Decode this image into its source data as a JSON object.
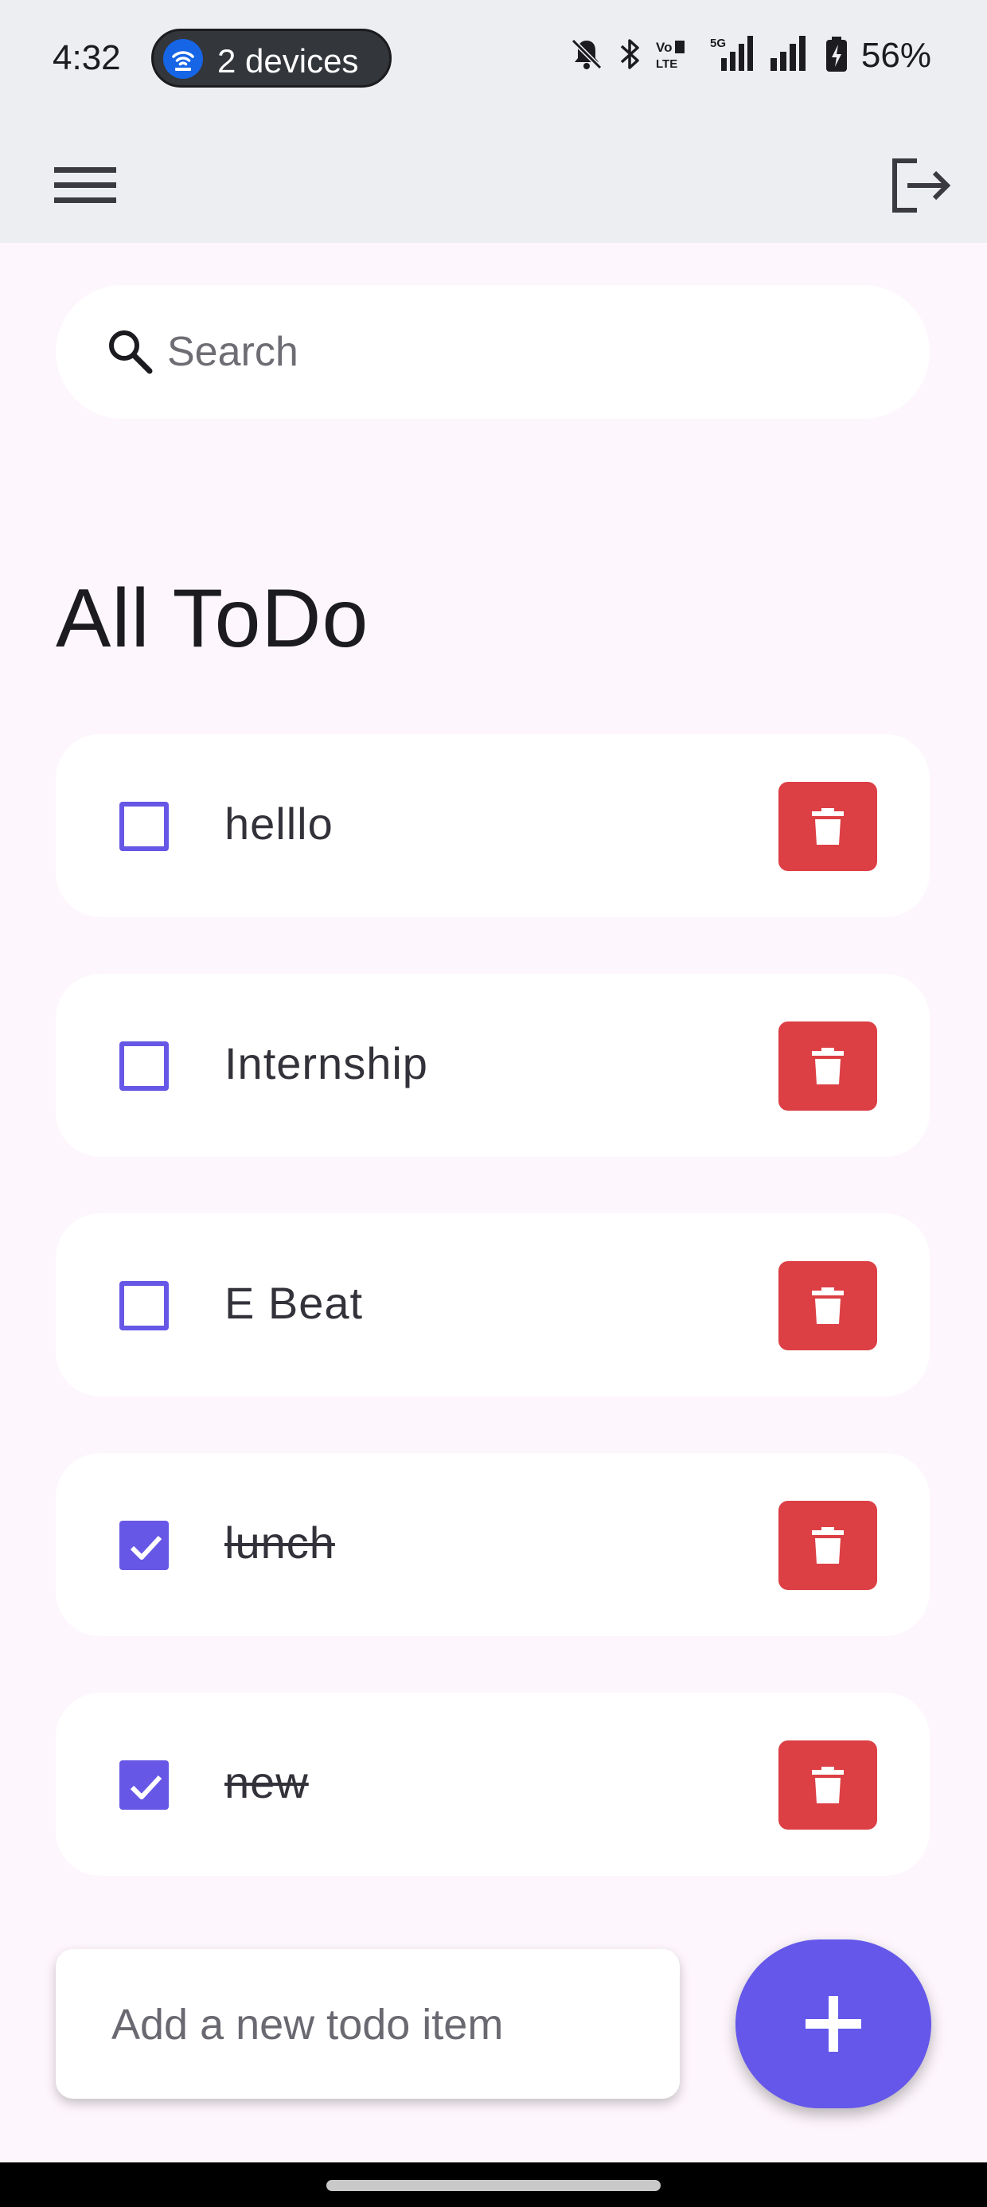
{
  "status_bar": {
    "time": "4:32",
    "hotspot_label": "2 devices",
    "battery": "56%",
    "icons": [
      "wifi-hotspot-icon",
      "bell-off-icon",
      "bluetooth-icon",
      "volte-icon",
      "signal-5g-icon",
      "signal-icon",
      "battery-charging-icon"
    ]
  },
  "app_bar": {
    "menu_icon": "menu-icon",
    "logout_icon": "logout-icon"
  },
  "search": {
    "placeholder": "Search",
    "value": ""
  },
  "page": {
    "title": "All ToDo"
  },
  "todos": [
    {
      "text": "helllo",
      "done": false
    },
    {
      "text": "Internship",
      "done": false
    },
    {
      "text": "E Beat",
      "done": false
    },
    {
      "text": "lunch",
      "done": true
    },
    {
      "text": "new",
      "done": true
    }
  ],
  "add_todo": {
    "placeholder": "Add a new todo item",
    "value": ""
  },
  "colors": {
    "accent": "#6457ea",
    "delete": "#dc3f44",
    "background": "#fdf6fc",
    "app_bar": "#eceef2"
  }
}
